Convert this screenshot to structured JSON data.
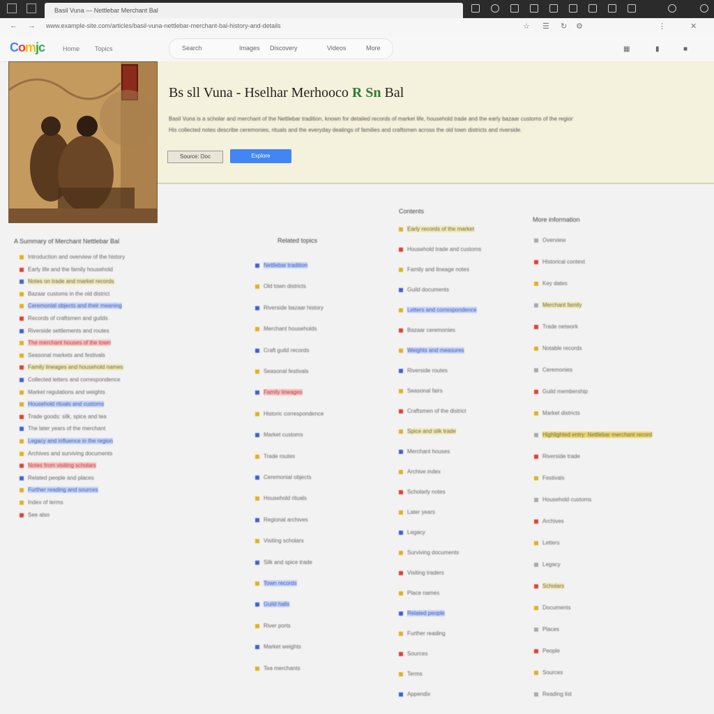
{
  "browser": {
    "tab_title": "Basil Vuna — Nettlebar Merchant Bal",
    "url": "www.example-site.com/articles/basil-vuna-nettlebar-merchant-bal-history-and-details"
  },
  "site": {
    "logo": [
      "C",
      "o",
      "m",
      "jc"
    ],
    "header_links": [
      "Home",
      "Topics"
    ],
    "search_tabs": [
      "Search",
      "Images",
      "Discovery",
      "Videos",
      "More"
    ]
  },
  "hero": {
    "title_main": "Bs sll Vuna - Hselhar Merhooco ",
    "title_highlight": "R Sn",
    "title_tail": " Bal",
    "desc_lines": [
      "Basil Vuna is a scholar and merchant of the Nettlebar tradition, known for detailed records of market life, household trade and the early bazaar customs of the region.",
      "His collected notes describe ceremonies, rituals and the everyday dealings of families and craftsmen across the old town districts and riverside."
    ],
    "chip_label": "Source: Doc",
    "button_label": "Explore"
  },
  "col1": {
    "heading": "A Summary of Merchant Nettlebar Bal",
    "rows": [
      "Introduction and overview of the history",
      "Early life and the family household",
      "Notes on trade and market records",
      "Bazaar customs in the old district",
      "Ceremonial objects and their meaning",
      "Records of craftsmen and guilds",
      "Riverside settlements and routes",
      "The merchant houses of the town",
      "Seasonal markets and festivals",
      "Family lineages and household names",
      "Collected letters and correspondence",
      "Market regulations and weights",
      "Household rituals and customs",
      "Trade goods: silk, spice and tea",
      "The later years of the merchant",
      "Legacy and influence in the region",
      "Archives and surviving documents",
      "Notes from visiting scholars",
      "Related people and places",
      "Further reading and sources",
      "Index of terms",
      "See also"
    ]
  },
  "col2": {
    "heading": "Related topics",
    "rows": [
      "Nettlebar tradition",
      "Old town districts",
      "Riverside bazaar history",
      "Merchant households",
      "Craft guild records",
      "Seasonal festivals",
      "Family lineages",
      "Historic correspondence",
      "Market customs",
      "Trade routes",
      "Ceremonial objects",
      "Household rituals",
      "Regional archives",
      "Visiting scholars",
      "Silk and spice trade",
      "Town records",
      "Guild halls",
      "River ports",
      "Market weights",
      "Tea merchants"
    ]
  },
  "col3": {
    "heading": "Contents",
    "rows": [
      "Early records of the market",
      "Household trade and customs",
      "Family and lineage notes",
      "Guild documents",
      "Letters and correspondence",
      "Bazaar ceremonies",
      "Weights and measures",
      "Riverside routes",
      "Seasonal fairs",
      "Craftsmen of the district",
      "Spice and silk trade",
      "Merchant houses",
      "Archive index",
      "Scholarly notes",
      "Later years",
      "Legacy",
      "Surviving documents",
      "Visiting traders",
      "Place names",
      "Related people",
      "Further reading",
      "Sources",
      "Terms",
      "Appendix"
    ]
  },
  "col4": {
    "heading": "More information",
    "rows": [
      "Overview",
      "Historical context",
      "Key dates",
      "Merchant family",
      "Trade network",
      "Notable records",
      "Ceremonies",
      "Guild membership",
      "Market districts",
      "Highlighted entry: Nettlebar merchant record",
      "Riverside trade",
      "Festivals",
      "Household customs",
      "Archives",
      "Letters",
      "Legacy",
      "Scholars",
      "Documents",
      "Places",
      "People",
      "Sources",
      "Reading list"
    ]
  },
  "colors": {
    "accent": "#4285f4",
    "hero_bg": "#f4f1dc",
    "highlight_green": "#2e7d32"
  }
}
